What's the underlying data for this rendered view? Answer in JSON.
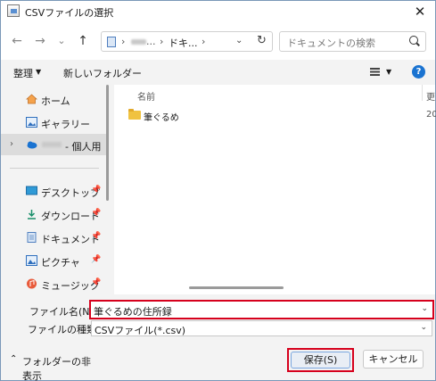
{
  "window": {
    "title": "CSVファイルの選択",
    "close_glyph": "✕"
  },
  "nav": {
    "back_glyph": "←",
    "forward_glyph": "→",
    "recent_glyph": "⌄",
    "up_glyph": "↑"
  },
  "address": {
    "sep1": "›",
    "blur_suffix": "...",
    "segment": "ドキ...",
    "sep2": "›",
    "dropdown_glyph": "⌄",
    "refresh_glyph": "↻"
  },
  "search": {
    "placeholder": "ドキュメントの検索"
  },
  "toolbar": {
    "organize_label": "整理",
    "organize_arrow": "▼",
    "new_folder_label": "新しいフォルダー",
    "view_arrow": "▼",
    "help_glyph": "?"
  },
  "sidebar": {
    "expander_glyph": "›",
    "pin_glyph": "📌",
    "items": [
      {
        "label": "ホーム",
        "icon": "home-icon"
      },
      {
        "label": "ギャラリー",
        "icon": "gallery-icon"
      },
      {
        "label": "- 個人用",
        "icon": "cloud-icon"
      },
      {
        "label": "デスクトップ",
        "icon": "desktop-icon"
      },
      {
        "label": "ダウンロード",
        "icon": "download-icon"
      },
      {
        "label": "ドキュメント",
        "icon": "document-icon"
      },
      {
        "label": "ピクチャ",
        "icon": "picture-icon"
      },
      {
        "label": "ミュージック",
        "icon": "music-icon"
      }
    ]
  },
  "files": {
    "columns": {
      "name": "名前",
      "date": "更"
    },
    "rows": [
      {
        "name": "筆ぐるめ",
        "date": "20",
        "icon": "folder-icon"
      }
    ]
  },
  "bottom": {
    "filename_label": "ファイル名(N):",
    "filename_value": "筆ぐるめの住所録",
    "filetype_label": "ファイルの種類(T):",
    "filetype_value": "CSVファイル(*.csv)",
    "dropdown_glyph": "⌄",
    "hide_folders_label": "フォルダーの非表示",
    "hide_folders_glyph": "⌃",
    "save_label": "保存(S)",
    "cancel_label": "キャンセル"
  },
  "colors": {
    "highlight": "#d6001c",
    "accent": "#1a73d1",
    "folder": "#f0c240"
  }
}
